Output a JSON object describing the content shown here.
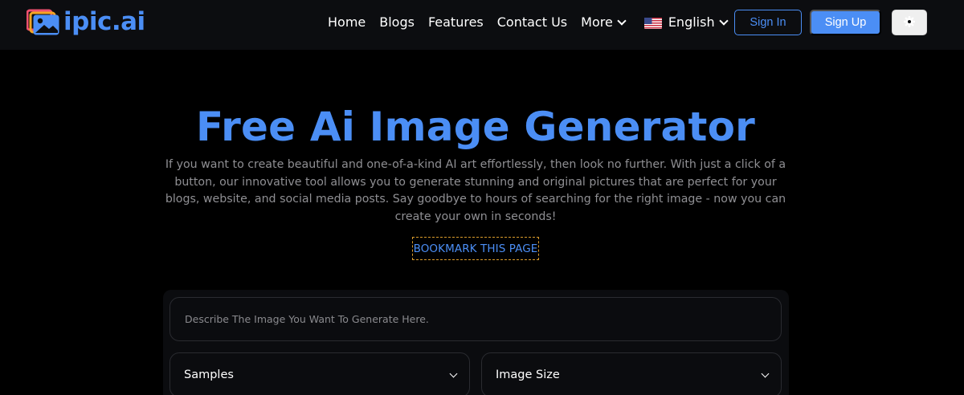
{
  "brand": {
    "name": "ipic.ai",
    "accent": "#4b8ef5"
  },
  "nav": {
    "links": [
      "Home",
      "Blogs",
      "Features",
      "Contact Us"
    ],
    "more": "More",
    "language": "English",
    "signin": "Sign In",
    "signup": "Sign Up",
    "theme_icon": "gear-icon"
  },
  "hero": {
    "title": "Free Ai Image Generator",
    "description": "If you want to create beautiful and one-of-a-kind AI art effortlessly, then look no further. With just a click of a button, our innovative tool allows you to generate stunning and original pictures that are perfect for your blogs, website, and social media posts. Say goodbye to hours of searching for the right image - now you can create your own in seconds!",
    "bookmark": "BOOKMARK THIS PAGE"
  },
  "form": {
    "prompt_placeholder": "Describe The Image You Want To Generate Here.",
    "samples_label": "Samples",
    "size_label": "Image Size"
  }
}
